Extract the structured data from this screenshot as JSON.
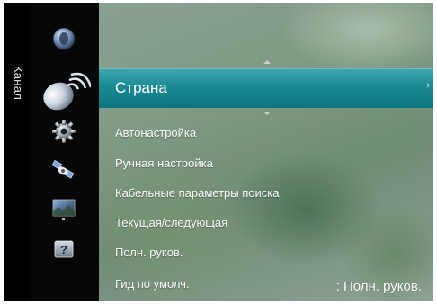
{
  "category": {
    "label": "Канал",
    "icons": [
      {
        "name": "picture-icon",
        "active": false
      },
      {
        "name": "channel-antenna-icon",
        "active": true
      },
      {
        "name": "setup-gear-icon",
        "active": false
      },
      {
        "name": "satellite-icon",
        "active": false
      },
      {
        "name": "media-thumbnail-icon",
        "active": false
      },
      {
        "name": "help-icon",
        "active": false
      }
    ]
  },
  "menu": {
    "selected": {
      "label": "Страна",
      "chevron": "›"
    },
    "items": [
      {
        "label": "Автонастройка"
      },
      {
        "label": "Ручная настройка"
      },
      {
        "label": "Кабельные  параметры поиска"
      },
      {
        "label": "Текущая/следующая"
      },
      {
        "label": "Полн. руков."
      },
      {
        "label": "Гид по умолч.",
        "value": ": Полн. руков."
      }
    ]
  },
  "help_icon_text": "?"
}
